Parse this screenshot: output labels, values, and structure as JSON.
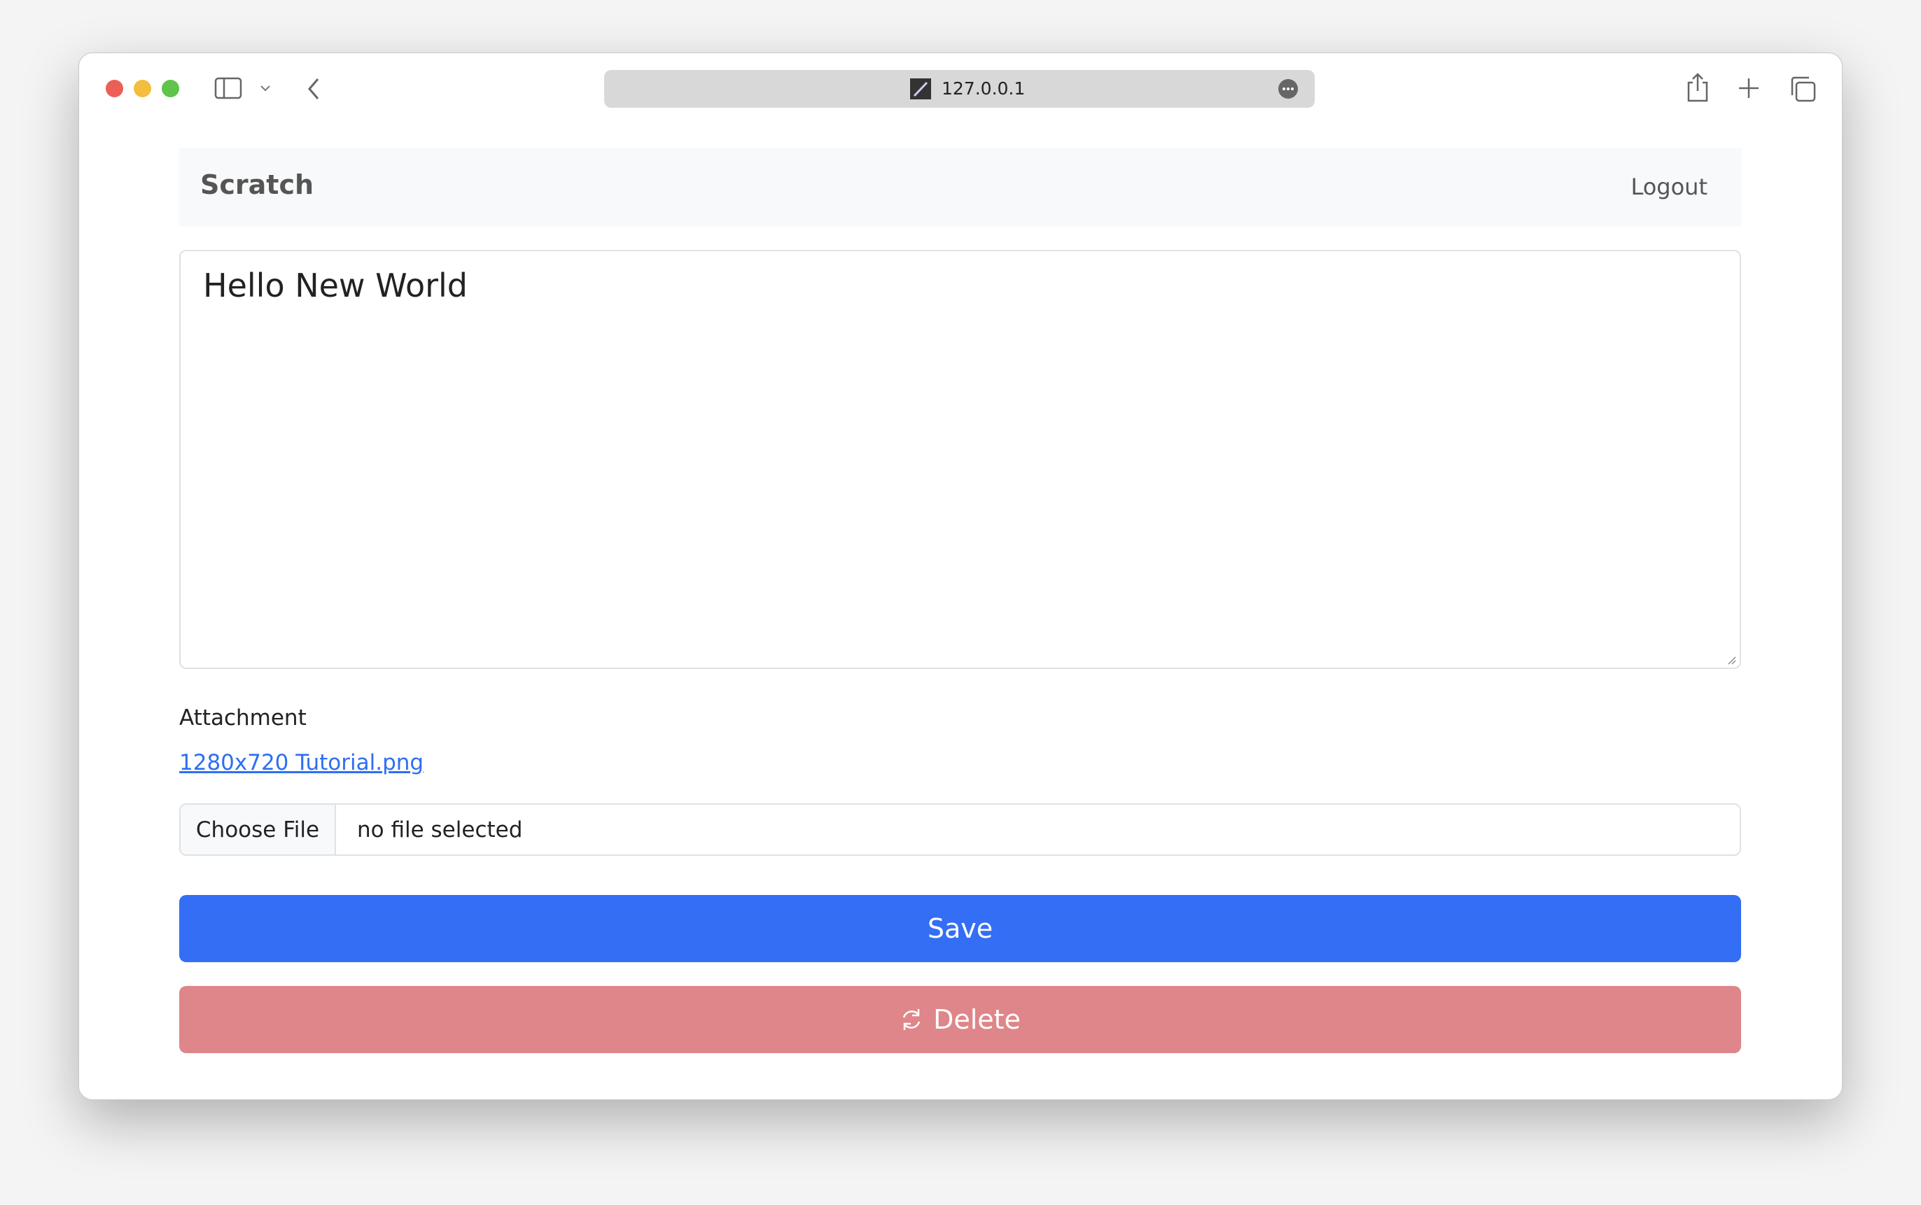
{
  "browser": {
    "url": "127.0.0.1",
    "traffic_lights": {
      "close": "#ec5f56",
      "minimize": "#f4bd3e",
      "zoom": "#5fc44a"
    }
  },
  "navbar": {
    "brand": "Scratch",
    "logout_label": "Logout"
  },
  "note": {
    "content": "Hello New World"
  },
  "attachment": {
    "label": "Attachment",
    "file_link": "1280x720 Tutorial.png",
    "choose_file_label": "Choose File",
    "file_status": "no file selected"
  },
  "actions": {
    "save_label": "Save",
    "delete_label": "Delete",
    "save_color": "#336ef5",
    "delete_color": "#de8689"
  }
}
